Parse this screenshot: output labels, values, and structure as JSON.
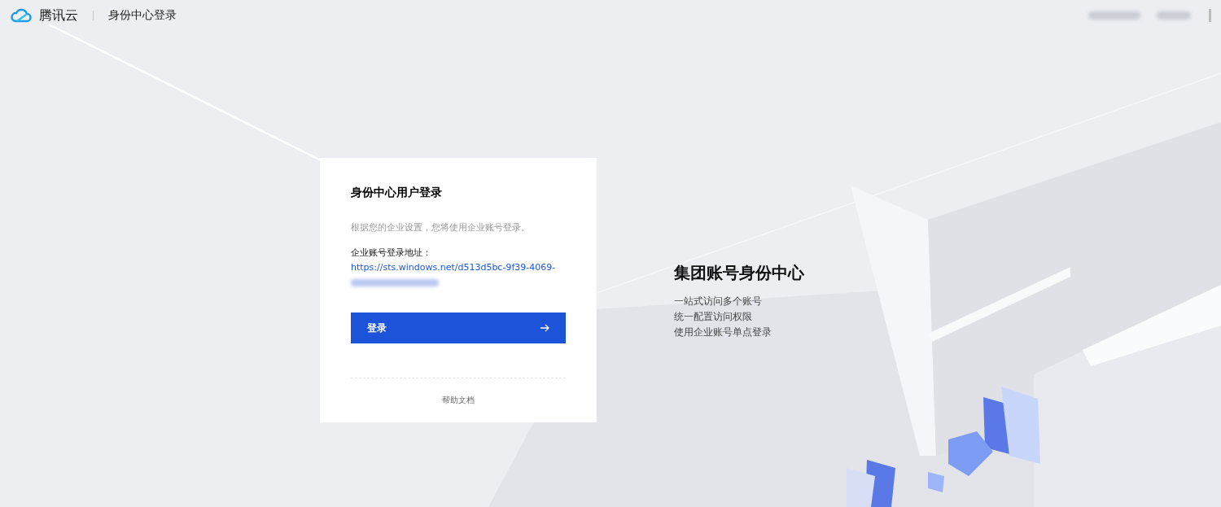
{
  "header": {
    "brand": "腾讯云",
    "title": "身份中心登录"
  },
  "login_card": {
    "title": "身份中心用户登录",
    "notice": "根据您的企业设置，您将使用企业账号登录。",
    "address_label": "企业账号登录地址：",
    "address_link": "https://sts.windows.net/d513d5bc-9f39-4069-",
    "login_button": "登录",
    "help_link": "帮助文档"
  },
  "promo": {
    "title": "集团账号身份中心",
    "lines": [
      "一站式访问多个账号",
      "统一配置访问权限",
      "使用企业账号单点登录"
    ]
  }
}
